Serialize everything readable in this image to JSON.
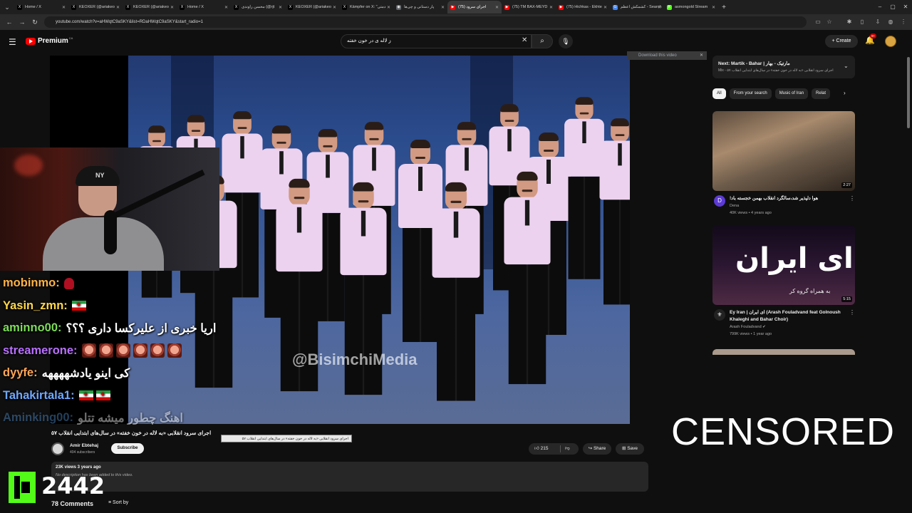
{
  "browser": {
    "tabs": [
      {
        "title": "Home / X",
        "fav_color": "#000000",
        "fav_glyph": "X"
      },
      {
        "title": "KEOXER (@ariakeo",
        "fav_color": "#000000",
        "fav_glyph": "X"
      },
      {
        "title": "KEOXER (@ariakeo",
        "fav_color": "#000000",
        "fav_glyph": "X"
      },
      {
        "title": "Home / X",
        "fav_color": "#000000",
        "fav_glyph": "X"
      },
      {
        "title": "محسن راوندی (@rjt",
        "fav_color": "#000000",
        "fav_glyph": "X"
      },
      {
        "title": "KEOXER (@ariakeo",
        "fav_color": "#000000",
        "fav_glyph": "X"
      },
      {
        "title": "Kämpfer on X: \"دمتی",
        "fav_color": "#000000",
        "fav_glyph": "X"
      },
      {
        "title": "پار دستانی و چی‌ها",
        "fav_color": "#5f6368",
        "fav_glyph": "◉"
      },
      {
        "title": "(75) اجرای سرود",
        "fav_color": "#ff0000",
        "fav_glyph": "▶",
        "active": true
      },
      {
        "title": "(75) TM BAX-MEYD",
        "fav_color": "#ff0000",
        "fav_glyph": "▶"
      },
      {
        "title": "(75) Hichkas - Ekhte",
        "fav_color": "#ff0000",
        "fav_glyph": "▶"
      },
      {
        "title": "کشمکش اعظم - Search",
        "fav_color": "#4285f4",
        "fav_glyph": "G"
      },
      {
        "title": "asmongold Stream",
        "fav_color": "#53fc18",
        "fav_glyph": "K"
      }
    ],
    "url": "youtube.com/watch?v=aHWqtC9aSKY&list=RDaHWqtC9aSKY&start_radio=1"
  },
  "header": {
    "logo_text": "Premium",
    "logo_country": "CA",
    "search_value": "ز لاله ی در خون خفته",
    "create_label": "Create",
    "notification_badge": "9+"
  },
  "player": {
    "watermark": "@BisimchiMedia",
    "download_label": "Download this video"
  },
  "chat": [
    {
      "user": "mobinmo:",
      "color": "#ffb347",
      "msg": "",
      "emotes": "heart"
    },
    {
      "user": "Yasin_zmn:",
      "color": "#ffd84a",
      "msg": "",
      "emotes": "flag1"
    },
    {
      "user": "aminno00:",
      "color": "#7ddc5a",
      "msg": "اریا خبری از علیرکسا داری ؟؟؟",
      "emotes": ""
    },
    {
      "user": "streamerone:",
      "color": "#b970ff",
      "msg": "",
      "emotes": "faces6"
    },
    {
      "user": "dyyfe:",
      "color": "#ffa657",
      "msg": "کی اینو یادشههههه",
      "emotes": ""
    },
    {
      "user": "Tahakirtala1:",
      "color": "#6fa8ff",
      "msg": "",
      "emotes": "flag2"
    },
    {
      "user": "Aminking00:",
      "color": "#4f8cc9",
      "msg": "اهنگ چطور میشه تتلو",
      "emotes": "",
      "faded": true
    }
  ],
  "video": {
    "title": "اجرای سرود انقلابی «به لاله در خون خفته» در سال‌های ابتدایی انقلاب ۵۷",
    "tooltip": "اجرای سرود انقلابی «به لاله در خون خفته» در سال‌های ابتدایی انقلاب ۵۷",
    "channel": "Amir Ebtehaj",
    "subscribers": "404 subscribers",
    "subscribe_label": "Subscribe",
    "likes": "215",
    "share_label": "Share",
    "save_label": "Save",
    "views_meta": "23K views  3 years ago",
    "description": "No description has been added to this video.",
    "comments": "78 Comments",
    "sort_label": "Sort by"
  },
  "sidebar": {
    "next_title": "Next: Martik - Bahar | مارتیک - بهار",
    "next_sub": "Mix - اجرای سرود انقلابی «به لاله در خون خفته» در سال‌های ابتدایی انقلاب ۵۷",
    "chips": [
      {
        "label": "All",
        "active": true
      },
      {
        "label": "From your search"
      },
      {
        "label": "Music of Iran"
      },
      {
        "label": "Relat"
      }
    ],
    "recs": [
      {
        "title": "هوا دلپذیر شد،سالگرد انقلاب بهمن خجسته باد!",
        "channel": "Dena",
        "meta": "40K views • 4 years ago",
        "duration": "2:27",
        "avatar_letter": "D",
        "avatar_color": "#5c3ad6",
        "verified": false
      },
      {
        "title": "Ey Iran | ای ایران (Arash Fouladvand feat Golnoush Khaleghi and Bahar Choir)",
        "channel": "Arash Fouladvand",
        "meta": "799K views • 1 year ago",
        "duration": "5:15",
        "avatar_letter": "",
        "avatar_color": "#222222",
        "verified": true,
        "thumb_text": "ای ایران",
        "thumb_subtext": "به همراه گروه کر"
      }
    ]
  },
  "overlay": {
    "viewer_count": "2442",
    "censored_label": "CENSORED",
    "kick_color": "#53fc18"
  }
}
